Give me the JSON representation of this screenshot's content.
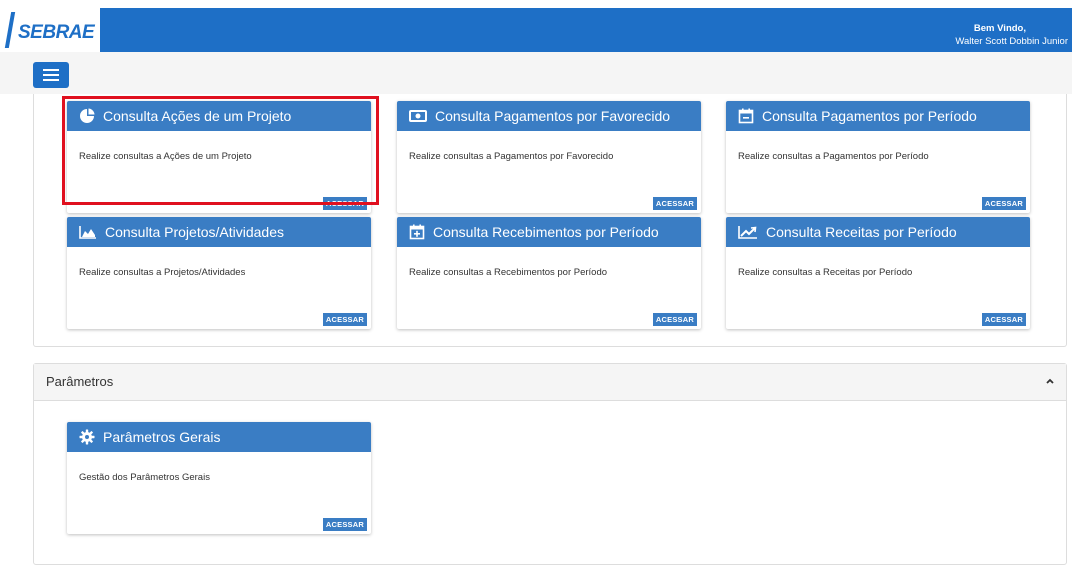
{
  "header": {
    "logo_text": "SEBRAE",
    "welcome_label": "Bem Vindo,",
    "user_name": "Walter Scott Dobbin Junior",
    "brand_color": "#1e6fc6"
  },
  "menu": {
    "toggle_icon": "hamburger-icon"
  },
  "cards": [
    {
      "icon": "pie-chart-icon",
      "title": "Consulta Ações de um Projeto",
      "description": "Realize consultas a Ações de um Projeto",
      "button": "ACESSAR"
    },
    {
      "icon": "money-icon",
      "title": "Consulta Pagamentos por Favorecido",
      "description": "Realize consultas a Pagamentos por Favorecido",
      "button": "ACESSAR"
    },
    {
      "icon": "calendar-minus-icon",
      "title": "Consulta Pagamentos por Período",
      "description": "Realize consultas a Pagamentos por Período",
      "button": "ACESSAR"
    },
    {
      "icon": "area-chart-icon",
      "title": "Consulta Projetos/Atividades",
      "description": "Realize consultas a Projetos/Atividades",
      "button": "ACESSAR"
    },
    {
      "icon": "calendar-plus-icon",
      "title": "Consulta Recebimentos por Período",
      "description": "Realize consultas a Recebimentos por Período",
      "button": "ACESSAR"
    },
    {
      "icon": "line-chart-icon",
      "title": "Consulta Receitas por Período",
      "description": "Realize consultas a Receitas por Período",
      "button": "ACESSAR"
    }
  ],
  "parametros": {
    "heading": "Parâmetros",
    "collapse_icon": "chevron-up-icon",
    "cards": [
      {
        "icon": "gear-icon",
        "title": "Parâmetros Gerais",
        "description": "Gestão dos Parâmetros Gerais",
        "button": "ACESSAR"
      }
    ]
  },
  "highlight_color": "#e0101f"
}
